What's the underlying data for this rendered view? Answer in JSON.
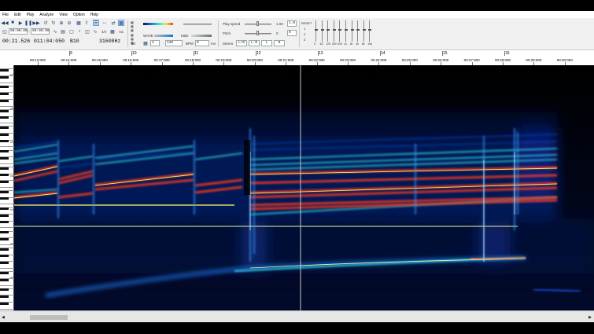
{
  "menu": [
    "File",
    "Edit",
    "Play",
    "Analyze",
    "View",
    "Option",
    "Help"
  ],
  "status": {
    "position": "00:21.526",
    "length": "011:04:050",
    "note": "B10",
    "frequency": "31608Hz"
  },
  "toolbar": {
    "time_from": "00:00:00",
    "time_to": "00:00:00",
    "meter_label": "4/4",
    "aa_label": "Aa",
    "wave_label": "WAVE",
    "midi_label": "MIDI",
    "beat_value": "4",
    "tempo_value": "120",
    "bpm_label": "BPM",
    "offset_value": "0",
    "ms_label": "ms",
    "loop_label": "60"
  },
  "playback": {
    "speed_label": "Play speed",
    "speed_value": "1.00",
    "speed_step": "1.0",
    "pitch_label": "Pitch",
    "pitch_value": "0",
    "pitch_step": "0",
    "stereo_label": "Stereo",
    "channel_buttons": [
      "L+R",
      "L-R",
      "L",
      "R"
    ]
  },
  "eq": {
    "reset_label": "RESET",
    "presets": [
      "1",
      "2",
      "3"
    ],
    "band_labels": [
      "0",
      "63",
      "125",
      "250",
      "500",
      "1k",
      "2k",
      "4k",
      "8k",
      "16k"
    ],
    "band_levels": [
      0.55,
      0.55,
      0.55,
      0.55,
      0.55,
      0.55,
      0.55,
      0.55,
      0.55,
      0.55
    ]
  },
  "ruler": {
    "bars": [
      "9",
      "10",
      "11",
      "12",
      "13",
      "14",
      "15",
      "16"
    ],
    "times": [
      "00:13:000",
      "00:14:000",
      "00:15:000",
      "00:16:000",
      "00:17:000",
      "00:18:000",
      "00:19:000",
      "00:20:000",
      "00:21:000",
      "00:22:000",
      "00:23:000",
      "00:24:000",
      "00:25:000",
      "00:26:000",
      "00:27:000",
      "00:28:000",
      "00:29:000",
      "00:30:000"
    ]
  },
  "keyboard": {
    "octave_labels": [
      "C7",
      "C6",
      "C5",
      "C4",
      "C3",
      "C2",
      "C1"
    ]
  },
  "colors": {
    "spectrogram_bg": "#000000",
    "intensity_low": "#0a1a6e",
    "intensity_mid": "#32d2e6",
    "intensity_high": "#ff3020",
    "cursor": "#c8c8c8"
  }
}
